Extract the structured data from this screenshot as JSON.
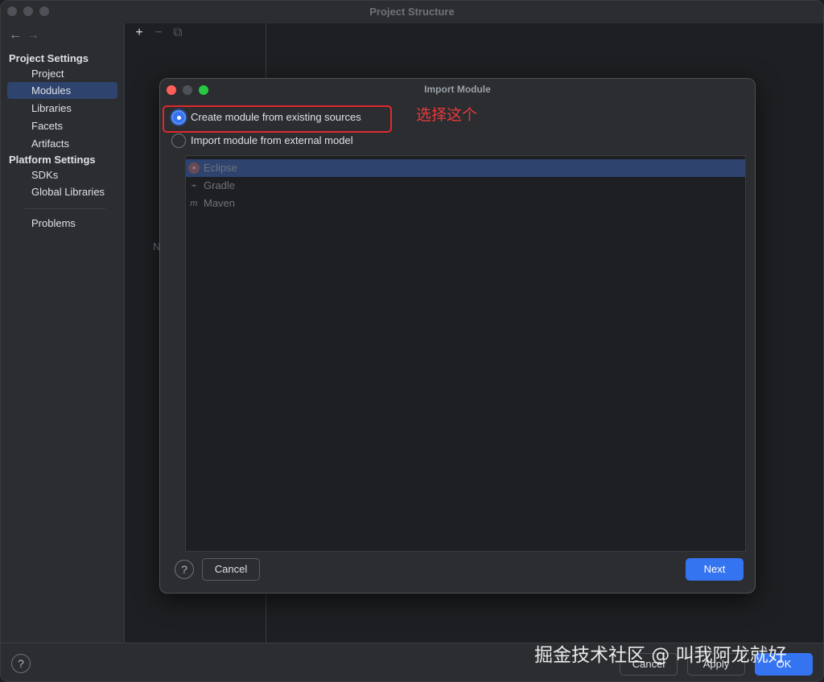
{
  "window": {
    "title": "Project Structure"
  },
  "sidebar": {
    "back": "←",
    "forward": "→",
    "project_settings": "Project Settings",
    "items_project": [
      {
        "label": "Project"
      },
      {
        "label": "Modules"
      },
      {
        "label": "Libraries"
      },
      {
        "label": "Facets"
      },
      {
        "label": "Artifacts"
      }
    ],
    "platform_settings": "Platform Settings",
    "items_platform": [
      {
        "label": "SDKs"
      },
      {
        "label": "Global Libraries"
      }
    ],
    "problems": "Problems"
  },
  "middle": {
    "add": "+",
    "remove": "−",
    "copy": "⧉",
    "empty_hint": "N"
  },
  "bottom": {
    "help": "?",
    "cancel": "Cancel",
    "apply": "Apply",
    "ok": "OK"
  },
  "watermark": "掘金技术社区 @ 叫我阿龙就好",
  "dialog": {
    "title": "Import Module",
    "option_create": "Create module from existing sources",
    "option_import": "Import module from external model",
    "annotation": "选择这个",
    "models": [
      {
        "label": "Eclipse"
      },
      {
        "label": "Gradle"
      },
      {
        "label": "Maven"
      }
    ],
    "help": "?",
    "cancel": "Cancel",
    "next": "Next"
  },
  "colors": {
    "accent": "#3574f0",
    "selection": "#2e436e",
    "annotation_red": "#e0282e"
  }
}
